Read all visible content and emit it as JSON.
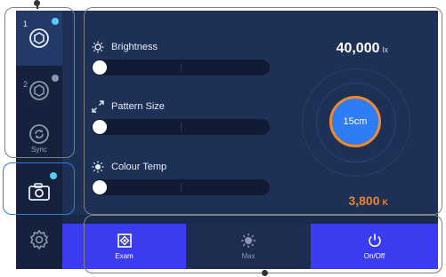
{
  "sidebar": {
    "preset1": {
      "number": "1",
      "icon": "lamp-hexagon-icon"
    },
    "preset2": {
      "number": "2",
      "icon": "lamp-hexagon-icon"
    },
    "sync": {
      "label": "Sync",
      "icon": "sync-icon"
    },
    "camera": {
      "icon": "camera-icon"
    },
    "settings": {
      "icon": "gear-icon"
    }
  },
  "controls": {
    "brightness": {
      "label": "Brightness",
      "icon": "sun-icon",
      "value": 0
    },
    "pattern_size": {
      "label": "Pattern Size",
      "icon": "expand-arrows-icon",
      "value": 0
    },
    "colour_temp": {
      "label": "Colour Temp",
      "icon": "temperature-sun-icon",
      "value": 0
    }
  },
  "readouts": {
    "lux_value": "40,000",
    "lux_unit": "lx",
    "pattern_value": "15cm",
    "kelvin_value": "3,800",
    "kelvin_unit": "K"
  },
  "bottom_bar": {
    "exam": {
      "label": "Exam",
      "icon": "focus-target-icon"
    },
    "max": {
      "label": "Max",
      "icon": "sun-icon"
    },
    "onoff": {
      "label": "On/Off",
      "icon": "power-icon"
    }
  },
  "colors": {
    "accent_cyan": "#4fd0f5",
    "accent_orange": "#f08a2c",
    "button_blue": "#3b3bf0",
    "panel_bg": "#1f3057"
  }
}
